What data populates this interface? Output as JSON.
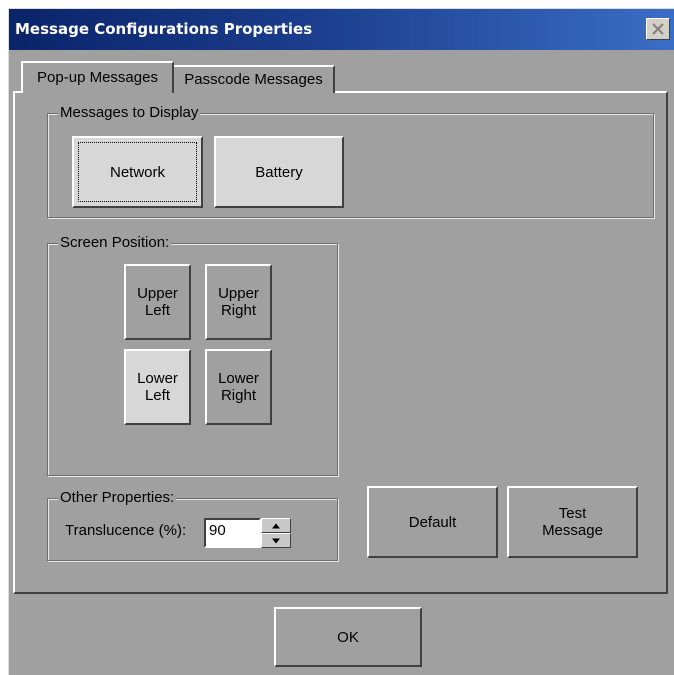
{
  "window": {
    "title": "Message Configurations Properties"
  },
  "tabs": [
    {
      "label": "Pop-up Messages",
      "active": true
    },
    {
      "label": "Passcode Messages",
      "active": false
    }
  ],
  "messages_group": {
    "legend": "Messages to Display",
    "buttons": [
      {
        "label": "Network",
        "state": "pressed-focused"
      },
      {
        "label": "Battery",
        "state": "pressed"
      }
    ]
  },
  "position_group": {
    "legend": "Screen Position:",
    "buttons": {
      "upper_left": {
        "line1": "Upper",
        "line2": "Left"
      },
      "upper_right": {
        "line1": "Upper",
        "line2": "Right"
      },
      "lower_left": {
        "line1": "Lower",
        "line2": "Left",
        "selected": true
      },
      "lower_right": {
        "line1": "Lower",
        "line2": "Right"
      }
    }
  },
  "other_group": {
    "legend": "Other Properties:",
    "translucence_label": "Translucence (%):",
    "translucence_value": "90"
  },
  "actions": {
    "default_label": "Default",
    "test_line1": "Test",
    "test_line2": "Message",
    "ok_label": "OK"
  },
  "colors": {
    "title_gradient_start": "#0a246a",
    "title_gradient_end": "#3a6ec4",
    "face": "#a0a0a0"
  }
}
